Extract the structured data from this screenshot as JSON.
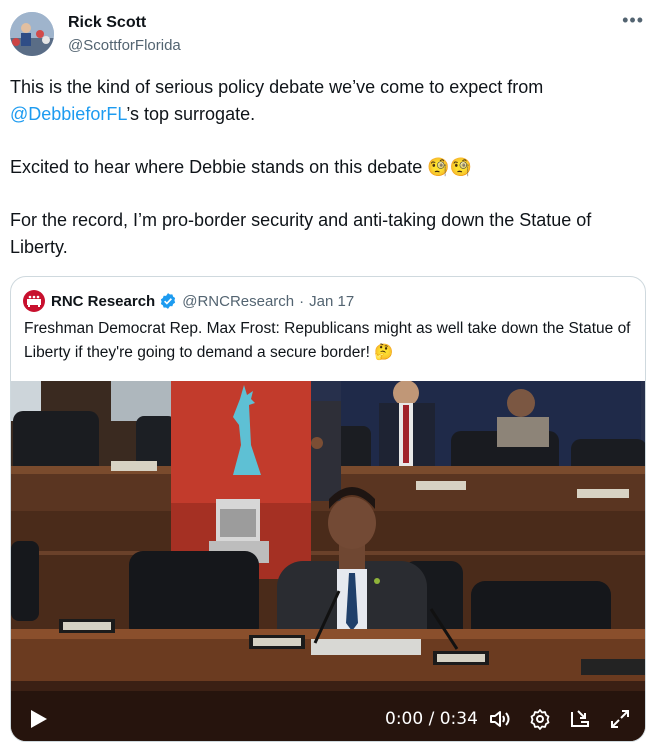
{
  "author": {
    "name": "Rick Scott",
    "handle": "@ScottforFlorida"
  },
  "tweet": {
    "line1_before": "This is the kind of serious policy debate we’ve come to expect from ",
    "mention": "@DebbieforFL",
    "line1_after": "’s top surrogate.",
    "para2": "Excited to hear where Debbie stands on this debate 🧐🧐",
    "para3": "For the record, I’m pro-border security and anti-taking down the Statue of Liberty."
  },
  "quote": {
    "name": "RNC Research",
    "handle": "@RNCResearch",
    "separator": "·",
    "date": "Jan 17",
    "text": "Freshman Democrat Rep. Max Frost: Republicans might as well take down the Statue of Liberty if they're going to demand a secure border! 🤔"
  },
  "video": {
    "time": "0:00 / 0:34",
    "nameplates": [
      "MR. MFUME",
      "MR. GROTHMAN",
      "MR. TIMMONS",
      "MR. GARCIA",
      "MR. FROST",
      "MR. LEE"
    ]
  },
  "icons": {
    "more": "more-icon",
    "verified": "verified-badge-icon",
    "play": "play-icon",
    "volume": "volume-icon",
    "settings": "settings-icon",
    "pip": "picture-in-picture-icon",
    "fullscreen": "fullscreen-icon"
  },
  "colors": {
    "link": "#1d9bf0",
    "secondary_text": "#536471",
    "verified": "#1d9bf0",
    "rnc_red": "#c8102e"
  }
}
